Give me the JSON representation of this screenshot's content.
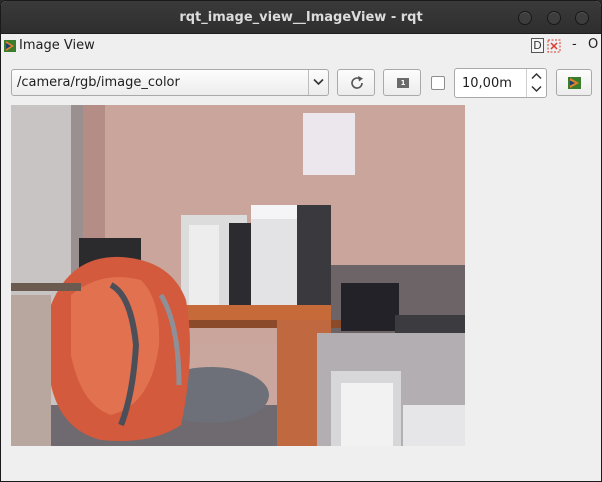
{
  "window": {
    "title": "rqt_image_view__ImageView - rqt"
  },
  "dock": {
    "title": "Image View",
    "d_label": "D",
    "minimize_label": "-",
    "close_label": "O"
  },
  "toolbar": {
    "topic_value": "/camera/rgb/image_color",
    "zoom_1_label": "1",
    "checkbox_checked": false,
    "spin_value": "10,00m"
  },
  "image": {
    "description_icon": "camera-image"
  },
  "colors": {
    "titlebar": "#2f2f2f",
    "window_bg": "#efeff0",
    "ros_icon_green": "#3a7d2c",
    "ros_icon_orange": "#e0822a"
  }
}
